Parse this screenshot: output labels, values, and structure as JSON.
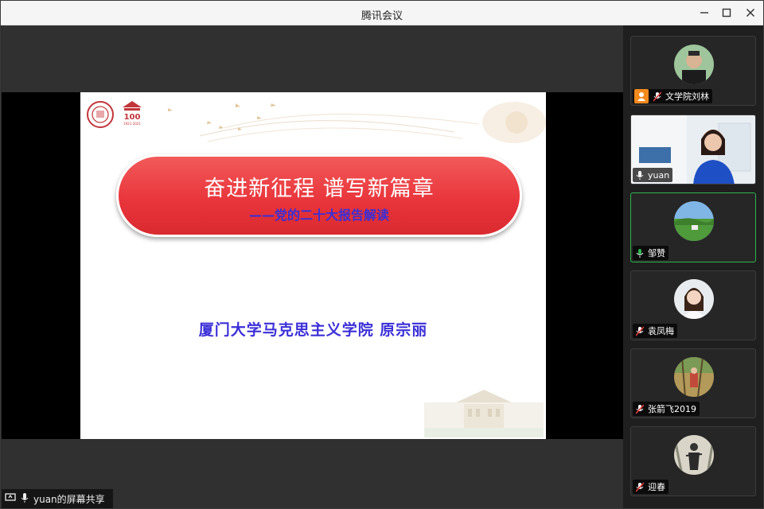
{
  "window": {
    "title": "腾讯会议",
    "controls": {
      "minimize_icon": "minimize-icon",
      "maximize_icon": "maximize-icon",
      "close_icon": "close-icon"
    }
  },
  "share": {
    "label": "yuan的屏幕共享",
    "slide": {
      "title": "奋进新征程  谱写新篇章",
      "subtitle": "——党的二十大报告解读",
      "author": "厦门大学马克思主义学院  原宗丽",
      "logo_text": "1921-2021"
    }
  },
  "participants": [
    {
      "name": "文学院刘林",
      "mic": "mic-muted",
      "speaking": false,
      "host_badge": true
    },
    {
      "name": "yuan",
      "mic": "mic-on",
      "speaking": false,
      "video": true
    },
    {
      "name": "邹赞",
      "mic": "mic-on",
      "speaking": true
    },
    {
      "name": "袁凤梅",
      "mic": "mic-muted",
      "speaking": false
    },
    {
      "name": "张箭飞2019",
      "mic": "mic-muted",
      "speaking": false
    },
    {
      "name": "迎春",
      "mic": "mic-muted",
      "speaking": false
    }
  ],
  "colors": {
    "speaking_border": "#2fb44e",
    "banner_red": "#e8333a",
    "slide_text_blue": "#3b2fd8",
    "host_badge": "#f28a1c"
  }
}
